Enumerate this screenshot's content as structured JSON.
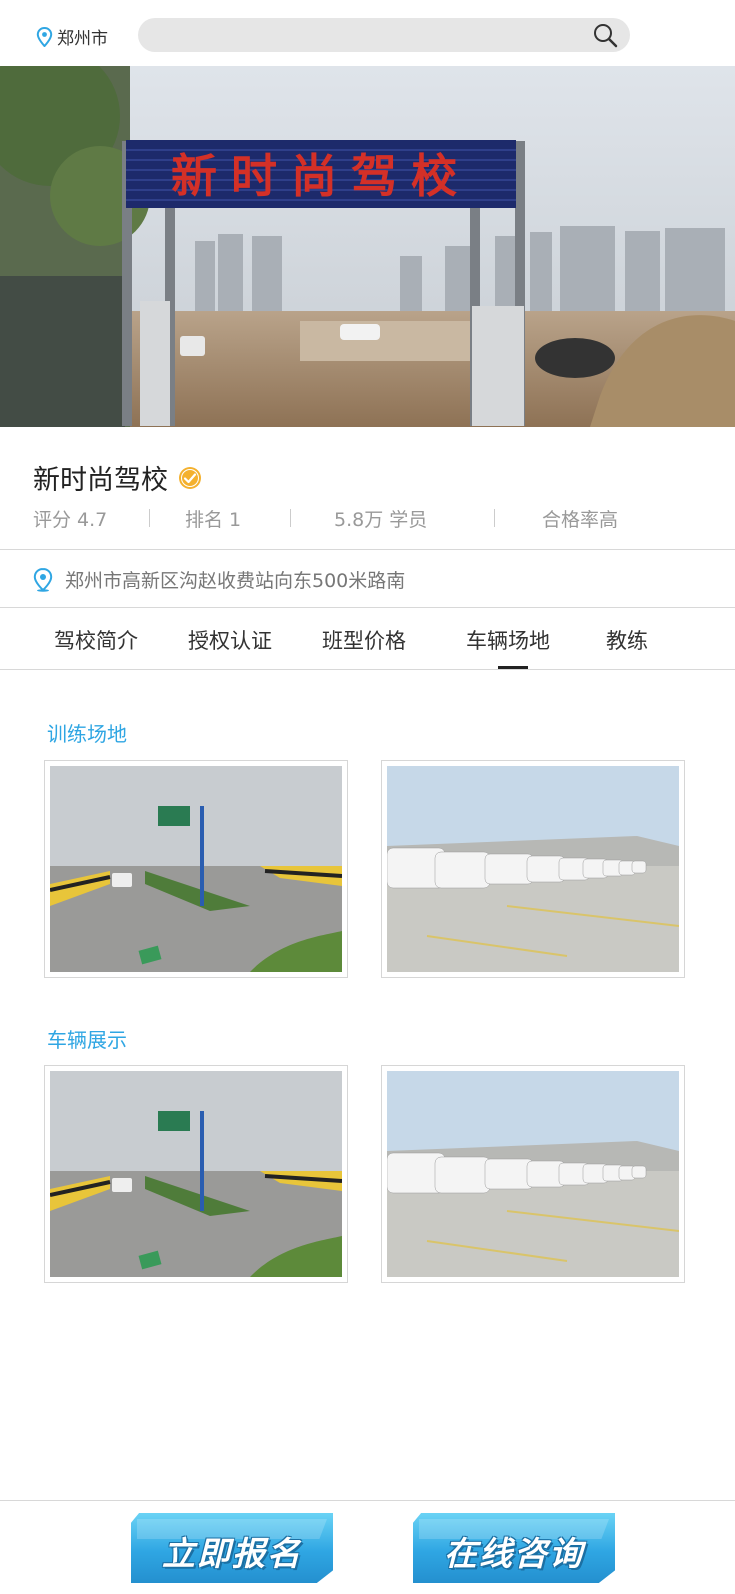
{
  "header": {
    "location": "郑州市",
    "search_placeholder": ""
  },
  "school": {
    "name": "新时尚驾校",
    "sign_text": "新时尚驾校",
    "stats": {
      "rating": "评分 4.7",
      "rank": "排名 1",
      "students": "5.8万 学员",
      "pass_rate": "合格率高"
    },
    "address": "郑州市高新区沟赵收费站向东500米路南"
  },
  "tabs": [
    {
      "label": "驾校简介",
      "active": false
    },
    {
      "label": "授权认证",
      "active": false
    },
    {
      "label": "班型价格",
      "active": false
    },
    {
      "label": "车辆场地",
      "active": true
    },
    {
      "label": "教练",
      "active": false
    }
  ],
  "sections": {
    "training_ground": {
      "title": "训练场地"
    },
    "vehicles": {
      "title": "车辆展示"
    }
  },
  "actions": {
    "signup": "立即报名",
    "consult": "在线咨询"
  },
  "colors": {
    "accent": "#2fa6e3",
    "verified": "#f4b12e"
  }
}
